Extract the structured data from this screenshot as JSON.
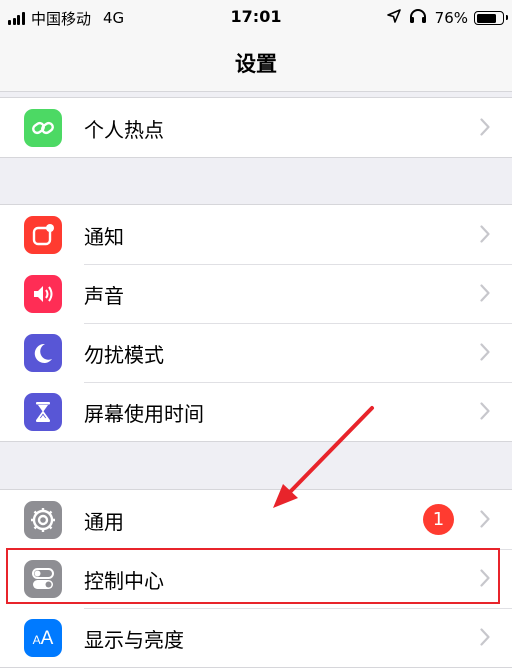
{
  "status_bar": {
    "carrier": "中国移动",
    "network": "4G",
    "time": "17:01",
    "battery_percent": "76%",
    "battery_level": 0.76,
    "icons": [
      "signal-icon",
      "location-icon",
      "headphones-icon",
      "battery-icon"
    ]
  },
  "nav": {
    "title": "设置"
  },
  "groups": [
    {
      "rows": [
        {
          "label": "个人热点",
          "icon": "hotspot-icon",
          "icon_color": "#4cd964"
        }
      ]
    },
    {
      "rows": [
        {
          "label": "通知",
          "icon": "notifications-icon",
          "icon_color": "#ff3b30"
        },
        {
          "label": "声音",
          "icon": "sounds-icon",
          "icon_color": "#ff2d55"
        },
        {
          "label": "勿扰模式",
          "icon": "moon-icon",
          "icon_color": "#5856d6"
        },
        {
          "label": "屏幕使用时间",
          "icon": "hourglass-icon",
          "icon_color": "#5856d6"
        }
      ]
    },
    {
      "rows": [
        {
          "label": "通用",
          "icon": "gear-icon",
          "icon_color": "#8e8e93",
          "badge": "1"
        },
        {
          "label": "控制中心",
          "icon": "toggles-icon",
          "icon_color": "#8e8e93",
          "highlighted": true
        },
        {
          "label": "显示与亮度",
          "icon": "text-size-icon",
          "icon_color": "#007aff"
        }
      ]
    }
  ],
  "colors": {
    "background": "#efeff4",
    "annotation": "#e8242b",
    "badge": "#ff3b30"
  }
}
